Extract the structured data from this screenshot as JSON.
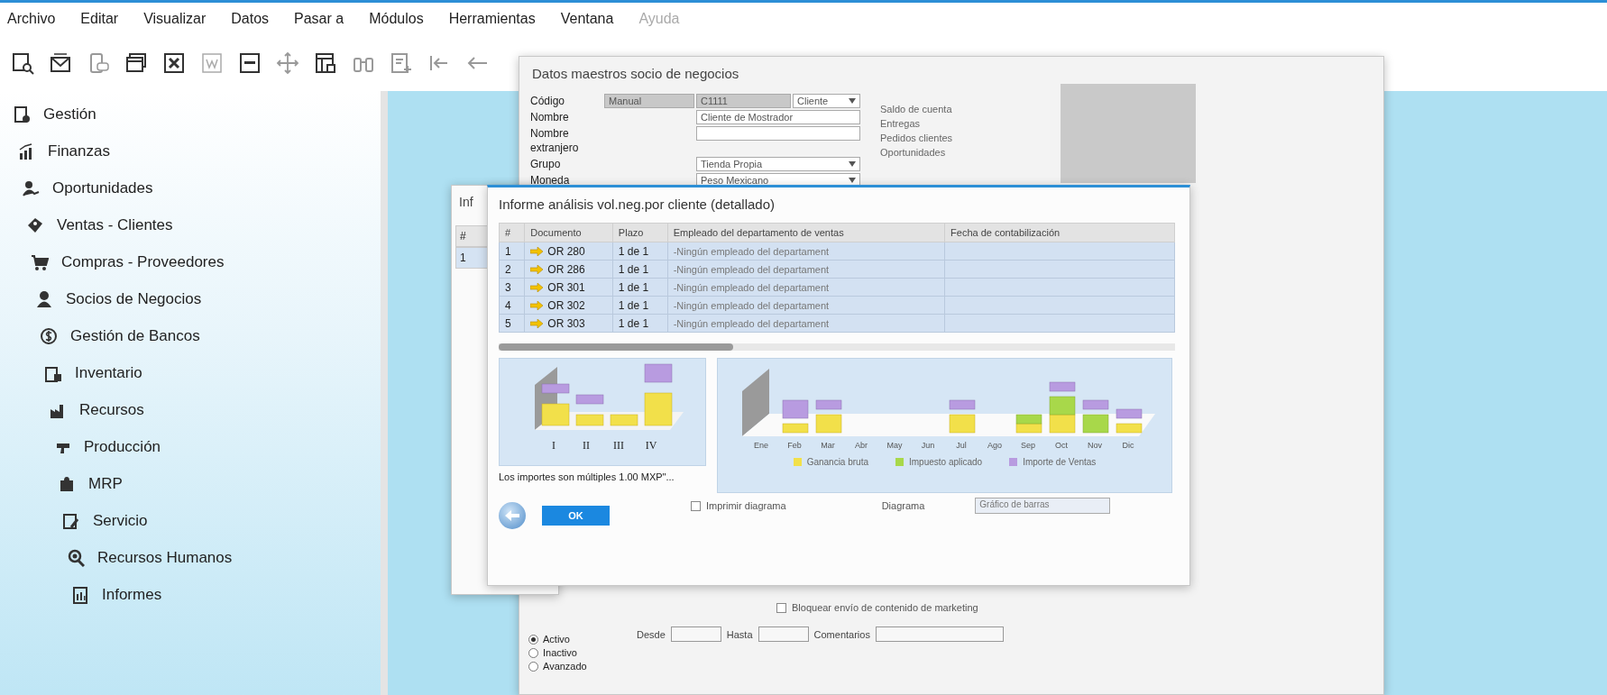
{
  "menu_bar": {
    "items": [
      {
        "label": "Archivo",
        "disabled": false
      },
      {
        "label": "Editar",
        "disabled": false
      },
      {
        "label": "Visualizar",
        "disabled": false
      },
      {
        "label": "Datos",
        "disabled": false
      },
      {
        "label": "Pasar a",
        "disabled": false
      },
      {
        "label": "Módulos",
        "disabled": false
      },
      {
        "label": "Herramientas",
        "disabled": false
      },
      {
        "label": "Ventana",
        "disabled": false
      },
      {
        "label": "Ayuda",
        "disabled": true
      }
    ]
  },
  "sidebar": {
    "items": [
      "Gestión",
      "Finanzas",
      "Oportunidades",
      "Ventas - Clientes",
      "Compras - Proveedores",
      "Socios de Negocios",
      "Gestión de Bancos",
      "Inventario",
      "Recursos",
      "Producción",
      "MRP",
      "Servicio",
      "Recursos Humanos",
      "Informes"
    ]
  },
  "master_window": {
    "title": "Datos maestros socio de negocios",
    "fields": [
      {
        "label": "Código",
        "kind": "code",
        "values": [
          "Manual",
          "C1111",
          "Cliente"
        ]
      },
      {
        "label": "Nombre",
        "kind": "text",
        "values": [
          "Cliente de Mostrador"
        ]
      },
      {
        "label": "Nombre extranjero",
        "kind": "text"
      },
      {
        "label": "Grupo",
        "kind": "select",
        "values": [
          "Tienda Propia"
        ]
      },
      {
        "label": "Moneda",
        "kind": "select",
        "values": [
          "Peso Mexicano"
        ]
      }
    ],
    "summary_labels": [
      "Saldo de cuenta",
      "Entregas",
      "Pedidos clientes",
      "Oportunidades"
    ],
    "block_marketing": {
      "label": "Bloquear envío de contenido de marketing",
      "checked": false
    },
    "date_fields": [
      "Desde",
      "Hasta",
      "Comentarios"
    ],
    "status_radios": [
      {
        "label": "Activo",
        "selected": true
      },
      {
        "label": "Inactivo",
        "selected": false
      },
      {
        "label": "Avanzado",
        "selected": false
      }
    ]
  },
  "back_report_window": {
    "title": "Inf",
    "columns": [
      "#"
    ],
    "rows": [
      "1"
    ]
  },
  "report_dialog": {
    "title": "Informe análisis vol.neg.por cliente (detallado)",
    "table": {
      "columns": [
        "#",
        "Documento",
        "Plazo",
        "Empleado del departamento de ventas",
        "Fecha de contabilización"
      ],
      "rows": [
        {
          "number": "1",
          "document": "OR 280",
          "term": "1 de 1",
          "employee": "-Ningún empleado del departament"
        },
        {
          "number": "2",
          "document": "OR 286",
          "term": "1 de 1",
          "employee": "-Ningún empleado del departament"
        },
        {
          "number": "3",
          "document": "OR 301",
          "term": "1 de 1",
          "employee": "-Ningún empleado del departament"
        },
        {
          "number": "4",
          "document": "OR 302",
          "term": "1 de 1",
          "employee": "-Ningún empleado del departament"
        },
        {
          "number": "5",
          "document": "OR 303",
          "term": "1 de 1",
          "employee": "-Ningún empleado del departament"
        }
      ]
    },
    "quarter_chart": {
      "x_labels": [
        "I",
        "II",
        "III",
        "IV"
      ]
    },
    "note": "Los importes son múltiples 1.00 MXP\"...",
    "month_chart": {
      "x_labels": [
        "Ene",
        "Feb",
        "Mar",
        "Abr",
        "May",
        "Jun",
        "Jul",
        "Ago",
        "Sep",
        "Oct",
        "Nov",
        "Dic"
      ],
      "legend": [
        {
          "label": "Ganancia bruta",
          "color": "#f2e04a"
        },
        {
          "label": "Impuesto aplicado",
          "color": "#a8d84a"
        },
        {
          "label": "Importe de Ventas",
          "color": "#b89be0"
        }
      ]
    },
    "print_chart": {
      "label": "Imprimir diagrama",
      "checked": false
    },
    "chart_type": {
      "label": "Diagrama",
      "value": "Gráfico de barras"
    },
    "ok_button": "OK"
  }
}
